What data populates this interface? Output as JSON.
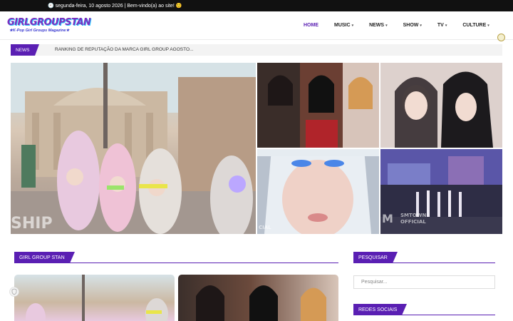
{
  "topbar": {
    "text": "🕘 segunda-feira, 10 agosto 2026 | Bem-vindo(a) ao site! 🙂"
  },
  "logo": {
    "main": "GIRLGROUPSTAN",
    "sub": "★K-Pop Girl Groups Magazine★"
  },
  "nav": [
    {
      "label": "HOME",
      "active": true,
      "chevron": false
    },
    {
      "label": "MUSIC",
      "active": false,
      "chevron": true
    },
    {
      "label": "NEWS",
      "active": false,
      "chevron": true
    },
    {
      "label": "SHOW",
      "active": false,
      "chevron": true
    },
    {
      "label": "TV",
      "active": false,
      "chevron": true
    },
    {
      "label": "CULTURE",
      "active": false,
      "chevron": true
    }
  ],
  "ticker": {
    "tag": "NEWS",
    "headline": "RANKING DE REPUTAÇÃO DA MARCA GIRL GROUP AGOSTO..."
  },
  "tiles": {
    "main_watermark": "SHIP",
    "t4_watermark": "CIAL",
    "t5_watermark_top": "SMTOWN",
    "t5_watermark_bottom": "OFFICIAL"
  },
  "sections": {
    "main_title": "GIRL GROUP STAN",
    "search_title": "PESQUISAR",
    "search_placeholder": "Pesquisar...",
    "social_title": "REDES SOCIAIS"
  },
  "colors": {
    "accent": "#5a1fb3",
    "topbar": "#111111"
  }
}
